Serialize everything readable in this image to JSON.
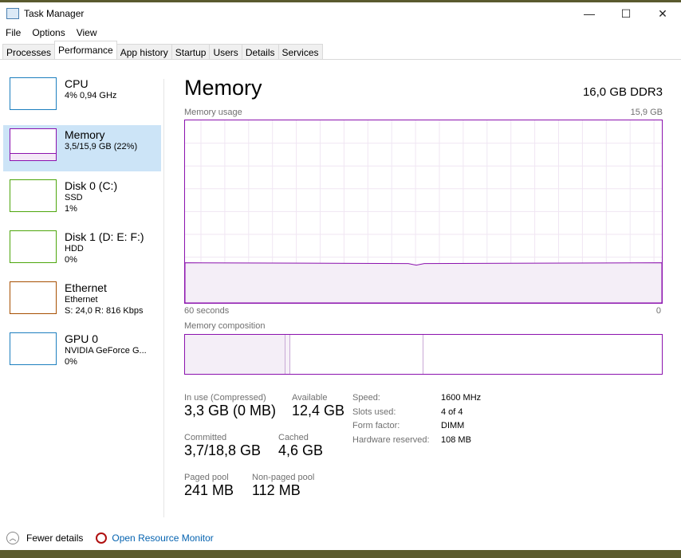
{
  "window": {
    "title": "Task Manager",
    "minimize": "—",
    "maximize": "☐",
    "close": "✕"
  },
  "menu": [
    "File",
    "Options",
    "View"
  ],
  "tabs": [
    "Processes",
    "Performance",
    "App history",
    "Startup",
    "Users",
    "Details",
    "Services"
  ],
  "sidebar": [
    {
      "name": "CPU",
      "l2": "4% 0,94 GHz",
      "l3": "",
      "color": "#1d7fbf"
    },
    {
      "name": "Memory",
      "l2": "3,5/15,9 GB (22%)",
      "l3": "",
      "color": "#8b12ae"
    },
    {
      "name": "Disk 0 (C:)",
      "l2": "SSD",
      "l3": "1%",
      "color": "#4da60c"
    },
    {
      "name": "Disk 1 (D: E: F:)",
      "l2": "HDD",
      "l3": "0%",
      "color": "#4da60c"
    },
    {
      "name": "Ethernet",
      "l2": "Ethernet",
      "l3": "S: 24,0 R: 816 Kbps",
      "color": "#a74f01"
    },
    {
      "name": "GPU 0",
      "l2": "NVIDIA GeForce G...",
      "l3": "0%",
      "color": "#1d7fbf"
    }
  ],
  "main": {
    "title": "Memory",
    "spec": "16,0 GB DDR3",
    "usage_label": "Memory usage",
    "max_label": "15,9 GB",
    "time_left": "60 seconds",
    "time_right": "0",
    "usage_percent": 22,
    "composition_label": "Memory composition",
    "stats": {
      "in_use_label": "In use (Compressed)",
      "in_use": "3,3 GB (0 MB)",
      "available_label": "Available",
      "available": "12,4 GB",
      "committed_label": "Committed",
      "committed": "3,7/18,8 GB",
      "cached_label": "Cached",
      "cached": "4,6 GB",
      "paged_label": "Paged pool",
      "paged": "241 MB",
      "nonpaged_label": "Non-paged pool",
      "nonpaged": "112 MB"
    },
    "props": [
      [
        "Speed:",
        "1600 MHz"
      ],
      [
        "Slots used:",
        "4 of 4"
      ],
      [
        "Form factor:",
        "DIMM"
      ],
      [
        "Hardware reserved:",
        "108 MB"
      ]
    ]
  },
  "footer": {
    "fewer": "Fewer details",
    "monitor": "Open Resource Monitor"
  }
}
